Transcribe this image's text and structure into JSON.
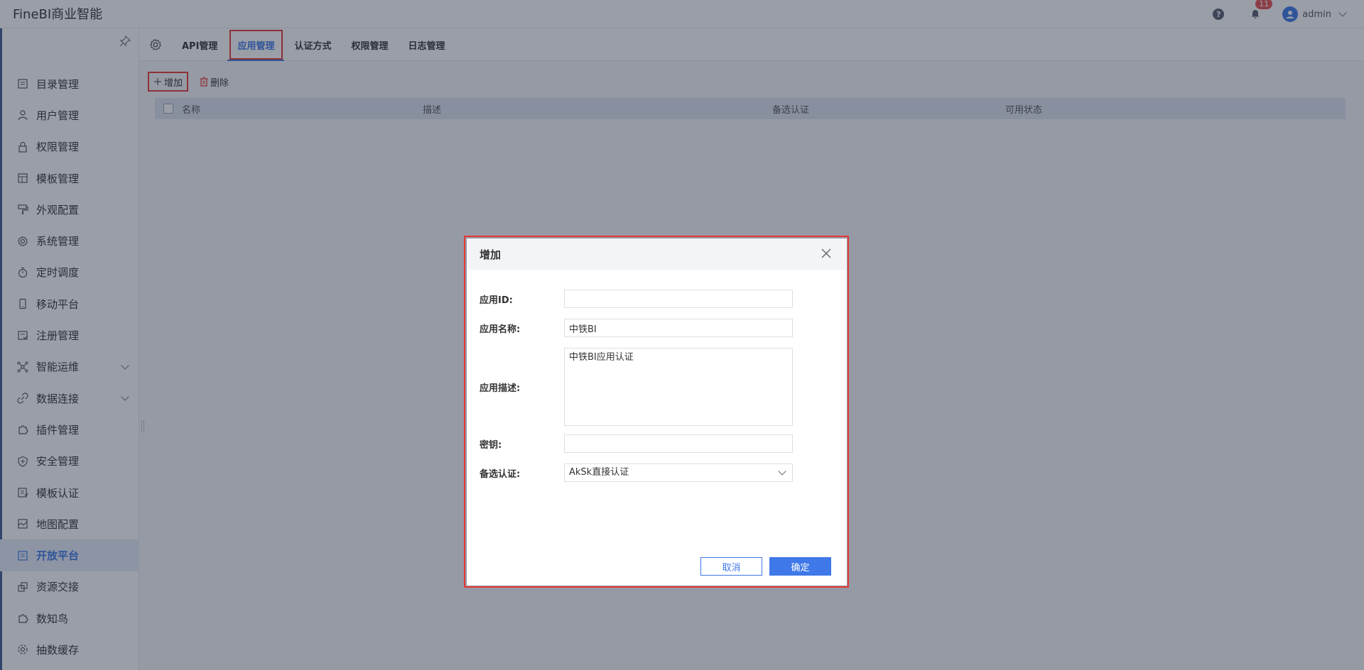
{
  "app": {
    "title": "FineBI商业智能",
    "user": "admin",
    "notifications": "11"
  },
  "sidebar": {
    "items": [
      {
        "label": "目录管理",
        "icon": "list-icon"
      },
      {
        "label": "用户管理",
        "icon": "user-icon"
      },
      {
        "label": "权限管理",
        "icon": "lock-icon"
      },
      {
        "label": "模板管理",
        "icon": "template-icon"
      },
      {
        "label": "外观配置",
        "icon": "brush-icon"
      },
      {
        "label": "系统管理",
        "icon": "gear-icon"
      },
      {
        "label": "定时调度",
        "icon": "timer-icon"
      },
      {
        "label": "移动平台",
        "icon": "mobile-icon"
      },
      {
        "label": "注册管理",
        "icon": "register-icon"
      },
      {
        "label": "智能运维",
        "icon": "network-icon"
      },
      {
        "label": "数据连接",
        "icon": "link-icon"
      },
      {
        "label": "插件管理",
        "icon": "plugin-icon"
      },
      {
        "label": "安全管理",
        "icon": "shield-icon"
      },
      {
        "label": "模板认证",
        "icon": "certify-icon"
      },
      {
        "label": "地图配置",
        "icon": "map-icon"
      },
      {
        "label": "开放平台",
        "icon": "open-platform-icon"
      },
      {
        "label": "资源交接",
        "icon": "exchange-icon"
      },
      {
        "label": "数知鸟",
        "icon": "bird-icon"
      },
      {
        "label": "抽数缓存",
        "icon": "cache-icon"
      }
    ],
    "active": "开放平台"
  },
  "tabs": [
    {
      "label": "API管理"
    },
    {
      "label": "应用管理"
    },
    {
      "label": "认证方式"
    },
    {
      "label": "权限管理"
    },
    {
      "label": "日志管理"
    }
  ],
  "toolbar": {
    "add_label": "增加",
    "delete_label": "删除"
  },
  "table": {
    "columns": [
      "名称",
      "描述",
      "备选认证",
      "可用状态"
    ]
  },
  "modal": {
    "title": "增加",
    "fields": {
      "app_id_label": "应用ID:",
      "app_id_value": "",
      "app_name_label": "应用名称:",
      "app_name_value": "中铁BI",
      "app_desc_label": "应用描述:",
      "app_desc_value": "中铁BI应用认证",
      "secret_label": "密钥:",
      "secret_value": "",
      "auth_label": "备选认证:",
      "auth_value": "AkSk直接认证"
    },
    "cancel_label": "取消",
    "ok_label": "确定"
  },
  "colors": {
    "accent": "#3f78e8",
    "highlight": "#e53935",
    "badge": "#e65151"
  }
}
